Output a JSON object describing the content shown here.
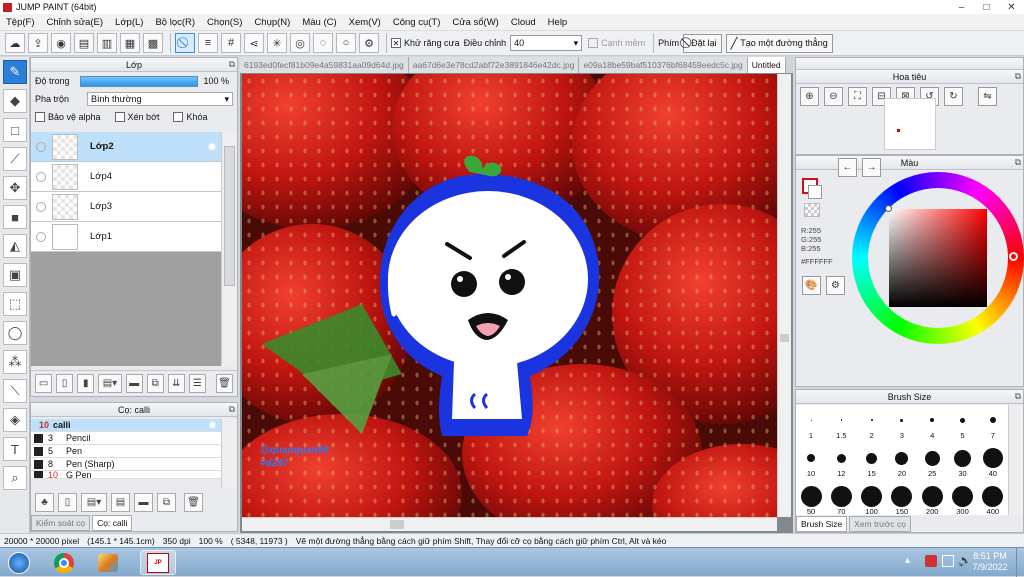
{
  "title": "JUMP PAINT (64bit)",
  "window_buttons": [
    "–",
    "□",
    "✕"
  ],
  "menu": [
    "Tệp(F)",
    "Chỉnh sửa(E)",
    "Lớp(L)",
    "Bộ lọc(R)",
    "Chọn(S)",
    "Chụp(N)",
    "Màu (C)",
    "Xem(V)",
    "Công cụ(T)",
    "Cửa sổ(W)",
    "Cloud",
    "Help"
  ],
  "toolbar": {
    "antialias_label": "Khử răng cưa",
    "adjust_label": "Điều chỉnh",
    "adjust_value": "40",
    "smooth_label": "Cạnh mềm",
    "pen_label": "Phím",
    "reset_label": "Đặt lại",
    "line_label": "Tạo một đường thẳng"
  },
  "layer_panel": {
    "title": "Lớp",
    "opacity_label": "Độ trong",
    "opacity_value": "100 %",
    "opacity": 1.0,
    "blend_label": "Pha trộn",
    "blend_value": "Bình thường",
    "protect_alpha": "Bảo vệ alpha",
    "clip": "Xén bớt",
    "lock": "Khóa",
    "layers": [
      {
        "name": "Lớp2",
        "selected": true
      },
      {
        "name": "Lớp4",
        "selected": false
      },
      {
        "name": "Lớp3",
        "selected": false
      },
      {
        "name": "Lớp1",
        "selected": false
      }
    ]
  },
  "brush_panel": {
    "title": "Cọ: calli",
    "items": [
      {
        "num": "10",
        "name": "calli"
      },
      {
        "num": "3",
        "name": "Pencil"
      },
      {
        "num": "5",
        "name": "Pen"
      },
      {
        "num": "8",
        "name": "Pen (Sharp)"
      },
      {
        "num": "10",
        "name": "G Pen"
      }
    ],
    "tab_control": "Kiểm soát cọ",
    "tab_brush": "Cọ: calli"
  },
  "file_tabs": [
    "6193ed0fecf81b09e4a59831aa09d64d.jpg",
    "aa67d6e3e78cd2abf72e3891846e42dc.jpg",
    "e09a18be59baf510376bf68459eedc5c.jpg",
    "Untitled"
  ],
  "watermark": [
    "@quanquan86",
    "#d247"
  ],
  "nav_panel": {
    "title": "Hoa tiêu"
  },
  "color_panel": {
    "title": "Màu",
    "r": "R:255",
    "g": "G:255",
    "b": "B:255",
    "hex": "#FFFFFF"
  },
  "size_panel": {
    "title": "Brush Size",
    "sizes": [
      "1",
      "1.5",
      "2",
      "3",
      "4",
      "5",
      "7",
      "10",
      "12",
      "15",
      "20",
      "25",
      "30",
      "40",
      "50",
      "70",
      "100",
      "150",
      "200",
      "300",
      "400"
    ],
    "tab_size": "Brush Size",
    "tab_preview": "Xem trước cọ"
  },
  "status": {
    "canvas": "20000 * 20000 pixel",
    "size": "(145.1 * 145.1cm)",
    "dpi": "350 dpi",
    "zoom": "100 %",
    "coords": "( 5348, 11973 )",
    "hint": "Vẽ một đường thẳng bằng cách giữ phím Shift, Thay đổi cỡ cọ bằng cách giữ phím Ctrl, Alt và kéo"
  },
  "taskbar": {
    "time": "8:51 PM",
    "date": "7/9/2022"
  },
  "colors": {
    "accent": "#2c7fd8",
    "blob_blue": "#1a35e0",
    "sprout": "#3aa838"
  }
}
